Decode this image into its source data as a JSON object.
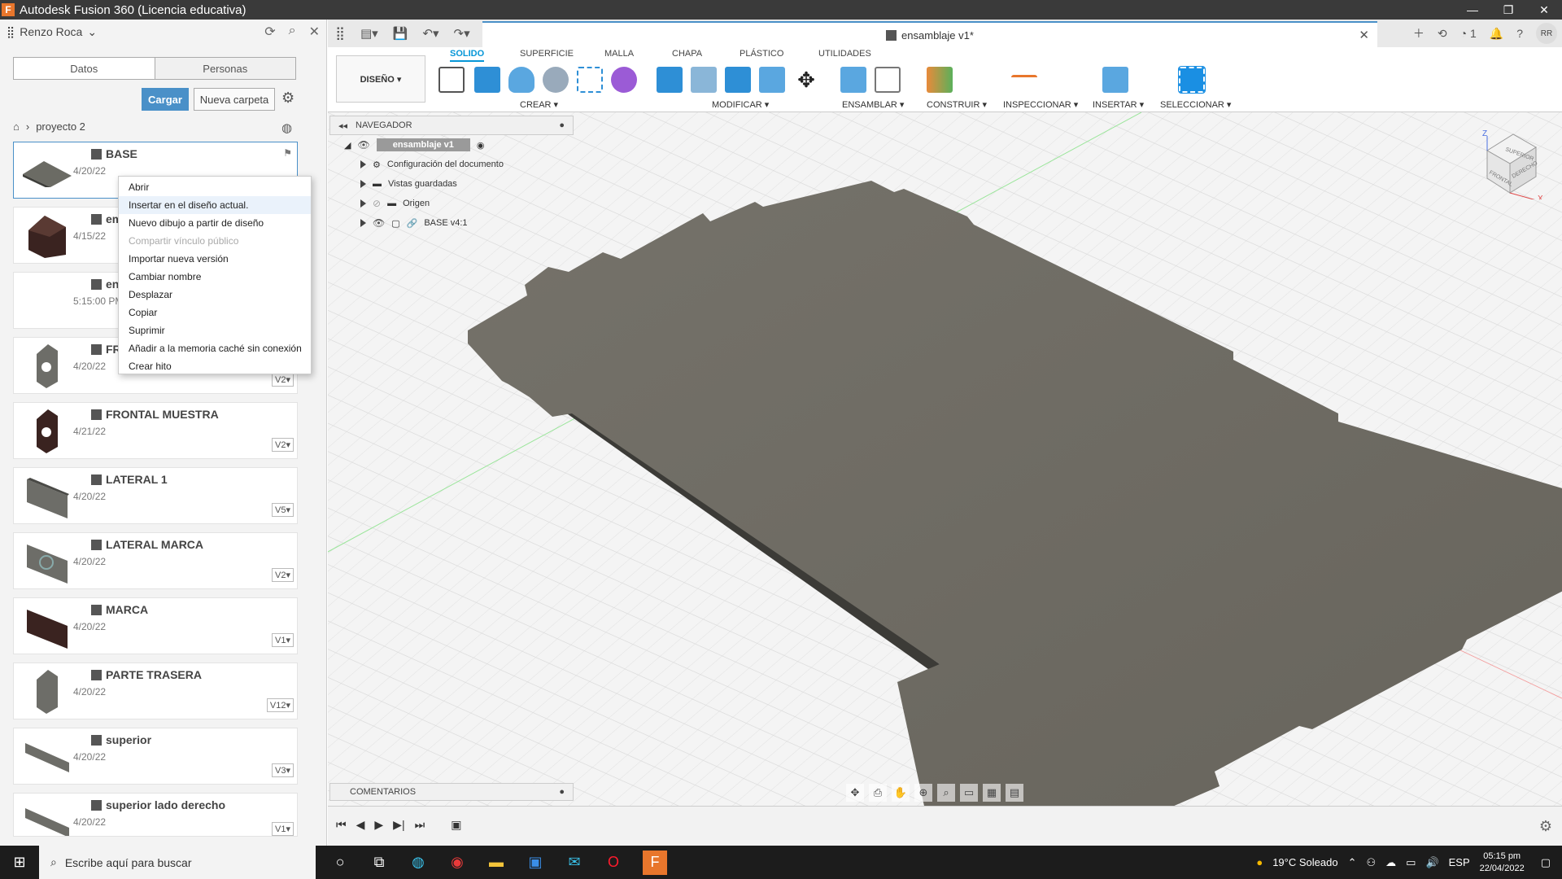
{
  "window": {
    "title": "Autodesk Fusion 360 (Licencia educativa)"
  },
  "datapanel": {
    "user": "Renzo Roca",
    "tabs": [
      "Datos",
      "Personas"
    ],
    "upload_label": "Cargar",
    "new_folder_label": "Nueva carpeta",
    "breadcrumb": "proyecto 2",
    "files": [
      {
        "name": "BASE",
        "date": "4/20/22",
        "version": ""
      },
      {
        "name": "emsa",
        "date": "4/15/22",
        "version": ""
      },
      {
        "name": "ensar",
        "date": "5:15:00 PM",
        "version": ""
      },
      {
        "name": "FRON",
        "date": "4/20/22",
        "version": "V2"
      },
      {
        "name": "FRONTAL MUESTRA",
        "date": "4/21/22",
        "version": "V2"
      },
      {
        "name": "LATERAL 1",
        "date": "4/20/22",
        "version": "V5"
      },
      {
        "name": "LATERAL MARCA",
        "date": "4/20/22",
        "version": "V2"
      },
      {
        "name": "MARCA",
        "date": "4/20/22",
        "version": "V1"
      },
      {
        "name": "PARTE TRASERA",
        "date": "4/20/22",
        "version": "V12"
      },
      {
        "name": "superior",
        "date": "4/20/22",
        "version": "V3"
      },
      {
        "name": "superior lado derecho",
        "date": "4/20/22",
        "version": "V1"
      }
    ]
  },
  "context_menu": [
    "Abrir",
    "Insertar en el diseño actual.",
    "Nuevo dibujo a partir de diseño",
    "Compartir vínculo público",
    "Importar nueva versión",
    "Cambiar nombre",
    "Desplazar",
    "Copiar",
    "Suprimir",
    "Añadir a la memoria caché sin conexión",
    "Crear hito"
  ],
  "doc_tab": {
    "title": "ensamblaje v1*"
  },
  "notifications_count": "1",
  "avatar_initials": "RR",
  "ribbon": {
    "workspace": "DISEÑO ▾",
    "tabs": [
      "SOLIDO",
      "SUPERFICIE",
      "MALLA",
      "CHAPA",
      "PLÁSTICO",
      "UTILIDADES"
    ],
    "groups": [
      "CREAR ▾",
      "MODIFICAR ▾",
      "ENSAMBLAR ▾",
      "CONSTRUIR ▾",
      "INSPECCIONAR ▾",
      "INSERTAR ▾",
      "SELECCIONAR ▾"
    ]
  },
  "navigator": {
    "title": "NAVEGADOR",
    "root": "ensamblaje v1",
    "items": [
      "Configuración del documento",
      "Vistas guardadas",
      "Origen",
      "BASE v4:1"
    ]
  },
  "comments_label": "COMENTARIOS",
  "viewcube": {
    "top": "SUPERIOR",
    "front": "FRONTAL",
    "right": "DERECHO",
    "z": "Z",
    "x": "X"
  },
  "taskbar": {
    "search_placeholder": "Escribe aquí para buscar",
    "weather": "19°C  Soleado",
    "lang": "ESP",
    "time": "05:15 pm",
    "date": "22/04/2022"
  },
  "colors": {
    "accent": "#0696d7",
    "model": "#6e6b62",
    "upload": "#4a90c8"
  }
}
